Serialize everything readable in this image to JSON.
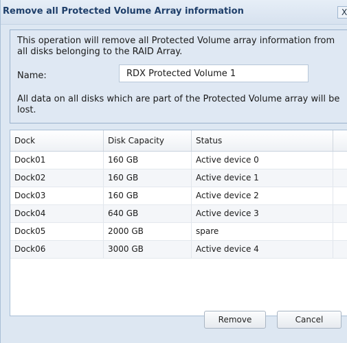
{
  "dialog": {
    "title": "Remove all Protected Volume Array information",
    "close_glyph": "X"
  },
  "info": {
    "description": "This operation will remove all Protected Volume array information from all disks belonging to the RAID Array.",
    "name_label": "Name:",
    "name_value": "RDX Protected Volume 1",
    "warning": "All data on all disks which are part of the Protected Volume array will be lost."
  },
  "grid": {
    "columns": [
      "Dock",
      "Disk Capacity",
      "Status"
    ],
    "rows": [
      [
        "Dock01",
        "160 GB",
        "Active device 0"
      ],
      [
        "Dock02",
        "160 GB",
        "Active device 1"
      ],
      [
        "Dock03",
        "160 GB",
        "Active device 2"
      ],
      [
        "Dock04",
        "640 GB",
        "Active device 3"
      ],
      [
        "Dock05",
        "2000 GB",
        "spare"
      ],
      [
        "Dock06",
        "3000 GB",
        "Active device 4"
      ]
    ]
  },
  "buttons": {
    "remove": "Remove",
    "cancel": "Cancel"
  }
}
